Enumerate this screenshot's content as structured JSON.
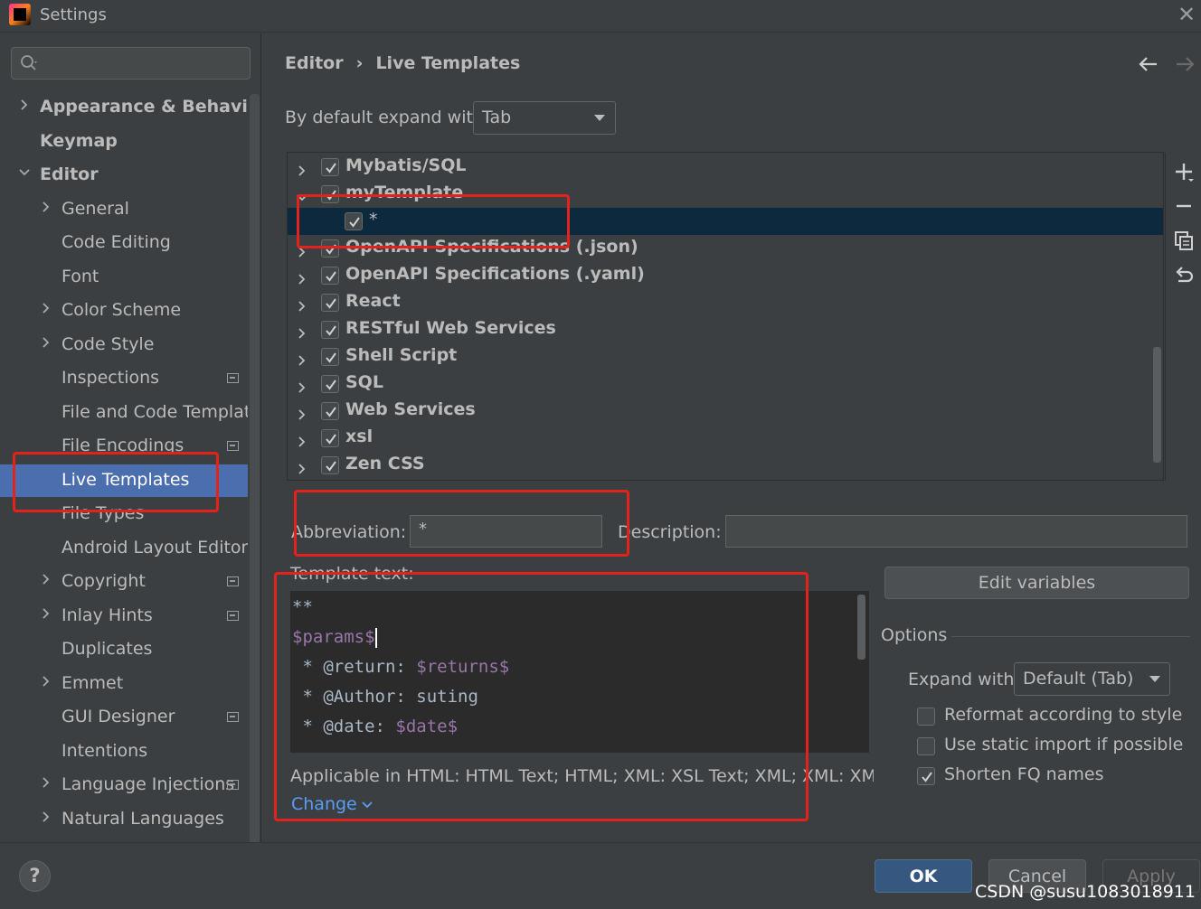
{
  "window": {
    "title": "Settings"
  },
  "search": {
    "placeholder": ""
  },
  "sidebar": {
    "items": [
      {
        "label": "Appearance & Behavior",
        "bold": true,
        "chevron": "right"
      },
      {
        "label": "Keymap",
        "bold": true
      },
      {
        "label": "Editor",
        "bold": true,
        "chevron": "down"
      },
      {
        "label": "General",
        "chevron": "right"
      },
      {
        "label": "Code Editing"
      },
      {
        "label": "Font"
      },
      {
        "label": "Color Scheme",
        "chevron": "right"
      },
      {
        "label": "Code Style",
        "chevron": "right"
      },
      {
        "label": "Inspections",
        "badge": true
      },
      {
        "label": "File and Code Templates"
      },
      {
        "label": "File Encodings",
        "badge": true
      },
      {
        "label": "Live Templates",
        "selected": true
      },
      {
        "label": "File Types"
      },
      {
        "label": "Android Layout Editor"
      },
      {
        "label": "Copyright",
        "chevron": "right",
        "badge": true
      },
      {
        "label": "Inlay Hints",
        "chevron": "right",
        "badge": true
      },
      {
        "label": "Duplicates"
      },
      {
        "label": "Emmet",
        "chevron": "right"
      },
      {
        "label": "GUI Designer",
        "badge": true
      },
      {
        "label": "Intentions"
      },
      {
        "label": "Language Injections",
        "chevron": "right",
        "badge": true
      },
      {
        "label": "Natural Languages",
        "chevron": "right"
      }
    ]
  },
  "breadcrumb": {
    "parent": "Editor",
    "separator": "›",
    "current": "Live Templates"
  },
  "expand_default": {
    "label": "By default expand with",
    "value": "Tab"
  },
  "tree": {
    "rows": [
      {
        "label": "Mybatis/SQL",
        "checked": true,
        "chevron": "right"
      },
      {
        "label": "myTemplate",
        "checked": true,
        "chevron": "down"
      },
      {
        "label": "*",
        "checked": true,
        "child": true,
        "selected": true
      },
      {
        "label": "OpenAPI Specifications (.json)",
        "checked": true,
        "chevron": "right"
      },
      {
        "label": "OpenAPI Specifications (.yaml)",
        "checked": true,
        "chevron": "right"
      },
      {
        "label": "React",
        "checked": true,
        "chevron": "right"
      },
      {
        "label": "RESTful Web Services",
        "checked": true,
        "chevron": "right"
      },
      {
        "label": "Shell Script",
        "checked": true,
        "chevron": "right"
      },
      {
        "label": "SQL",
        "checked": true,
        "chevron": "right"
      },
      {
        "label": "Web Services",
        "checked": true,
        "chevron": "right"
      },
      {
        "label": "xsl",
        "checked": true,
        "chevron": "right"
      },
      {
        "label": "Zen CSS",
        "checked": true,
        "chevron": "right"
      }
    ]
  },
  "tree_tools": [
    "add-icon",
    "remove-icon",
    "copy-icon",
    "restore-icon"
  ],
  "form": {
    "abbreviation_label": "Abbreviation:",
    "abbreviation_value": "*",
    "description_label": "Description:",
    "description_value": "",
    "template_text_label": "Template text:",
    "code_lines": [
      {
        "plain": "**",
        "var": ""
      },
      {
        "plain": "",
        "var": "$params$"
      },
      {
        "plain": " * @return: ",
        "var": "$returns$"
      },
      {
        "plain": " * @Author: suting",
        "var": ""
      },
      {
        "plain": " * @date: ",
        "var": "$date$"
      }
    ],
    "applicable": "Applicable in HTML: HTML Text; HTML; XML: XSL Text; XML; XML: XML te...",
    "change_link": "Change"
  },
  "edit_variables": "Edit variables",
  "options": {
    "title": "Options",
    "expand_with_label": "Expand with",
    "expand_with_value": "Default (Tab)",
    "checkboxes": [
      {
        "label": "Reformat according to style",
        "checked": false
      },
      {
        "label": "Use static import if possible",
        "checked": false
      },
      {
        "label": "Shorten FQ names",
        "checked": true
      }
    ]
  },
  "footer": {
    "help": "?",
    "ok": "OK",
    "cancel": "Cancel",
    "apply": "Apply"
  },
  "watermark": "CSDN @susu1083018911",
  "colors": {
    "selection": "#4b6eaf",
    "tree_selection": "#0d293e",
    "annotation": "#e3221b",
    "ok": "#365880",
    "template_var": "#9876aa"
  }
}
